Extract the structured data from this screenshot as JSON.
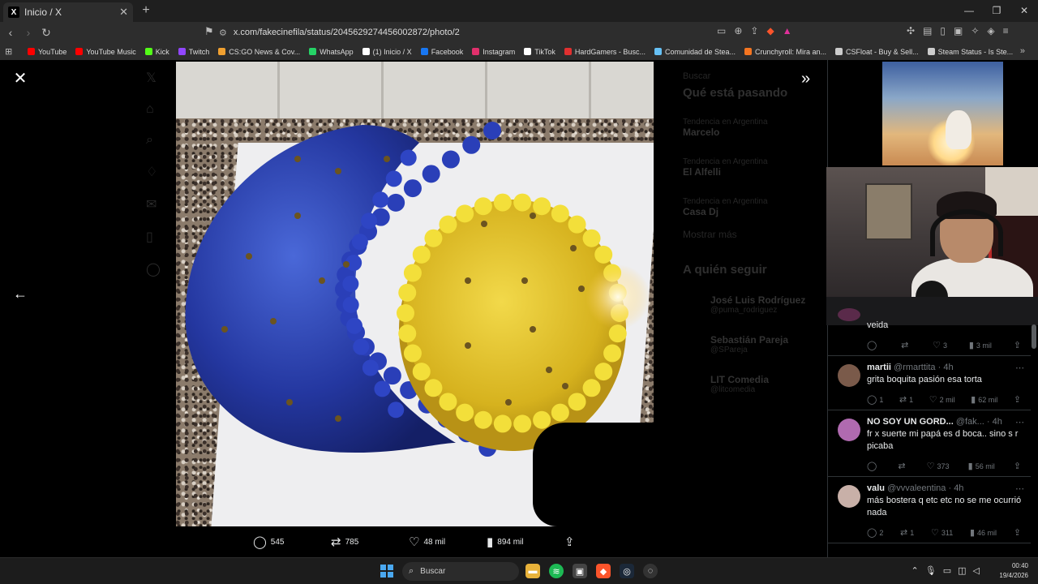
{
  "browser": {
    "tab_title": "Inicio / X",
    "tab_icon": "X",
    "url": "x.com/fakecinefila/status/2045629274456002872/photo/2",
    "bookmarks": [
      {
        "label": "YouTube",
        "color": "#ff0000"
      },
      {
        "label": "YouTube Music",
        "color": "#ff0000"
      },
      {
        "label": "Kick",
        "color": "#53fc18"
      },
      {
        "label": "Twitch",
        "color": "#9146ff"
      },
      {
        "label": "CS:GO News & Cov...",
        "color": "#f0a030"
      },
      {
        "label": "WhatsApp",
        "color": "#25d366"
      },
      {
        "label": "(1) Inicio / X",
        "color": "#ffffff"
      },
      {
        "label": "Facebook",
        "color": "#1877f2"
      },
      {
        "label": "Instagram",
        "color": "#e1306c"
      },
      {
        "label": "TikTok",
        "color": "#ffffff"
      },
      {
        "label": "HardGamers - Busc...",
        "color": "#e03030"
      },
      {
        "label": "Comunidad de Stea...",
        "color": "#66c0f4"
      },
      {
        "label": "Crunchyroll: Mira an...",
        "color": "#f47521"
      },
      {
        "label": "CSFloat - Buy & Sell...",
        "color": "#cccccc"
      },
      {
        "label": "Steam Status - Is Ste...",
        "color": "#cccccc"
      }
    ]
  },
  "background_page": {
    "search_placeholder": "Buscar",
    "trending_title": "Qué está pasando",
    "trends": [
      {
        "context": "Tendencia en Argentina",
        "name": "Marcelo"
      },
      {
        "context": "Tendencia en Argentina",
        "name": "El Alfelli"
      },
      {
        "context": "Tendencia en Argentina",
        "name": "Casa Dj"
      }
    ],
    "show_more": "Mostrar más",
    "follow_title": "A quién seguir",
    "follow": [
      {
        "name": "José Luis Rodríguez",
        "handle": "@puma_rodriguez"
      },
      {
        "name": "Sebastián Pareja",
        "handle": "@SPareja"
      },
      {
        "name": "LIT Comedia",
        "handle": "@litcomedia"
      }
    ]
  },
  "tweet_actions": {
    "replies": "545",
    "reposts": "785",
    "likes": "48 mil",
    "views": "894 mil"
  },
  "replies": [
    {
      "partial": true,
      "text": "veida",
      "reply_count": "",
      "repost_count": "",
      "like_count": "3",
      "view_count": "3 mil",
      "avatar_color": "#5a2a4a"
    },
    {
      "name": "martii",
      "handle": "@rmarttita",
      "time": "4h",
      "text": "grita boquita pasión esa torta",
      "reply_count": "1",
      "repost_count": "1",
      "like_count": "2 mil",
      "view_count": "62 mil",
      "avatar_color": "#7a5a4a"
    },
    {
      "name": "NO SOY UN GORD...",
      "handle": "@fak...",
      "time": "4h",
      "text": "fr x suerte mi papá es d boca.. sino s r picaba",
      "reply_count": "",
      "repost_count": "",
      "like_count": "373",
      "view_count": "56 mil",
      "avatar_color": "#b06ab0"
    },
    {
      "name": "valu",
      "handle": "@vvvaleentina",
      "time": "4h",
      "text": "más bostera q etc etc no se me ocurrió nada",
      "reply_count": "2",
      "repost_count": "1",
      "like_count": "311",
      "view_count": "46 mil",
      "avatar_color": "#c8b0a8"
    }
  ],
  "taskbar": {
    "search_label": "Buscar",
    "time": "00:40",
    "date": "19/4/2026"
  }
}
